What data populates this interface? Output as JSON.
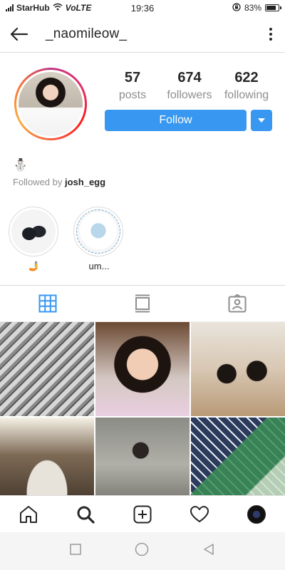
{
  "status_bar": {
    "carrier": "StarHub",
    "network": "VoLTE",
    "time": "19:36",
    "battery": "83%"
  },
  "header": {
    "username": "_naomileow_",
    "back_icon": "arrow-left-icon",
    "more_icon": "kebab-menu-icon"
  },
  "profile": {
    "stats": [
      {
        "value": "57",
        "label": "posts"
      },
      {
        "value": "674",
        "label": "followers"
      },
      {
        "value": "622",
        "label": "following"
      }
    ],
    "follow_label": "Follow",
    "bio_emoji": "⛄",
    "followed_by_prefix": "Followed by ",
    "followed_by_user": "josh_egg"
  },
  "highlights": [
    {
      "label": "🤳"
    },
    {
      "label": "um..."
    }
  ],
  "tabs": [
    "grid-view-icon",
    "feed-view-icon",
    "tagged-icon"
  ],
  "colors": {
    "accent": "#3897f0",
    "text": "#262626",
    "secondary": "#8e8e8e",
    "divider": "#dbdbdb"
  },
  "bottom_nav": [
    "home-icon",
    "search-icon",
    "add-post-icon",
    "activity-heart-icon",
    "profile-avatar"
  ],
  "system_nav": [
    "recent-apps-icon",
    "home-circle-icon",
    "back-triangle-icon"
  ]
}
